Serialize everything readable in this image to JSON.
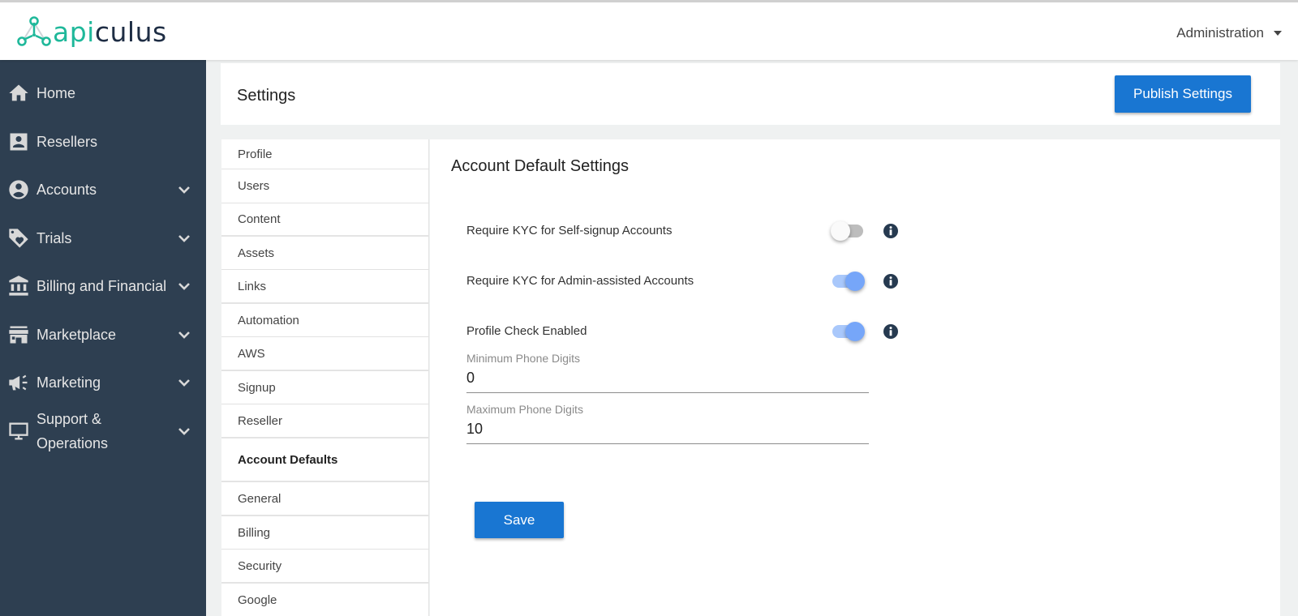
{
  "topbar": {
    "logo_api": "api",
    "logo_rest": "culus",
    "admin_menu": "Administration"
  },
  "sidebar": {
    "items": [
      {
        "label": "Home",
        "icon": "home-icon",
        "expandable": false
      },
      {
        "label": "Resellers",
        "icon": "contact-card-icon",
        "expandable": false
      },
      {
        "label": "Accounts",
        "icon": "account-circle-icon",
        "expandable": true
      },
      {
        "label": "Trials",
        "icon": "tag-heart-icon",
        "expandable": true
      },
      {
        "label": "Billing and Financial",
        "icon": "bank-icon",
        "expandable": true
      },
      {
        "label": "Marketplace",
        "icon": "store-icon",
        "expandable": true
      },
      {
        "label": "Marketing",
        "icon": "megaphone-icon",
        "expandable": true
      },
      {
        "label": "Support & Operations",
        "label_line1": "Support &",
        "label_line2": "Operations",
        "icon": "monitor-icon",
        "expandable": true
      }
    ]
  },
  "header": {
    "title": "Settings",
    "publish_label": "Publish Settings"
  },
  "settings_nav": {
    "items": [
      {
        "label": "Profile"
      },
      {
        "label": "Users"
      },
      {
        "label": "Content"
      },
      {
        "label": "Assets"
      },
      {
        "label": "Links"
      },
      {
        "label": "Automation"
      },
      {
        "label": "AWS"
      },
      {
        "label": "Signup"
      },
      {
        "label": "Reseller"
      },
      {
        "label": "Account Defaults",
        "active": true
      },
      {
        "label": "General"
      },
      {
        "label": "Billing"
      },
      {
        "label": "Security"
      },
      {
        "label": "Google"
      }
    ]
  },
  "content": {
    "title": "Account Default Settings",
    "toggles": [
      {
        "label": "Require KYC for Self-signup Accounts",
        "enabled": false
      },
      {
        "label": "Require KYC for Admin-assisted Accounts",
        "enabled": true
      },
      {
        "label": "Profile Check Enabled",
        "enabled": true
      }
    ],
    "fields": [
      {
        "label": "Minimum Phone Digits",
        "value": "0"
      },
      {
        "label": "Maximum Phone Digits",
        "value": "10"
      }
    ],
    "save_label": "Save"
  },
  "colors": {
    "primary": "#1976d2",
    "sidebar_bg": "#2e3f51",
    "logo_accent": "#1fb89a",
    "logo_dark": "#1e2d44",
    "toggle_on": "#76a6f9",
    "toggle_off": "#bdbdbd"
  }
}
